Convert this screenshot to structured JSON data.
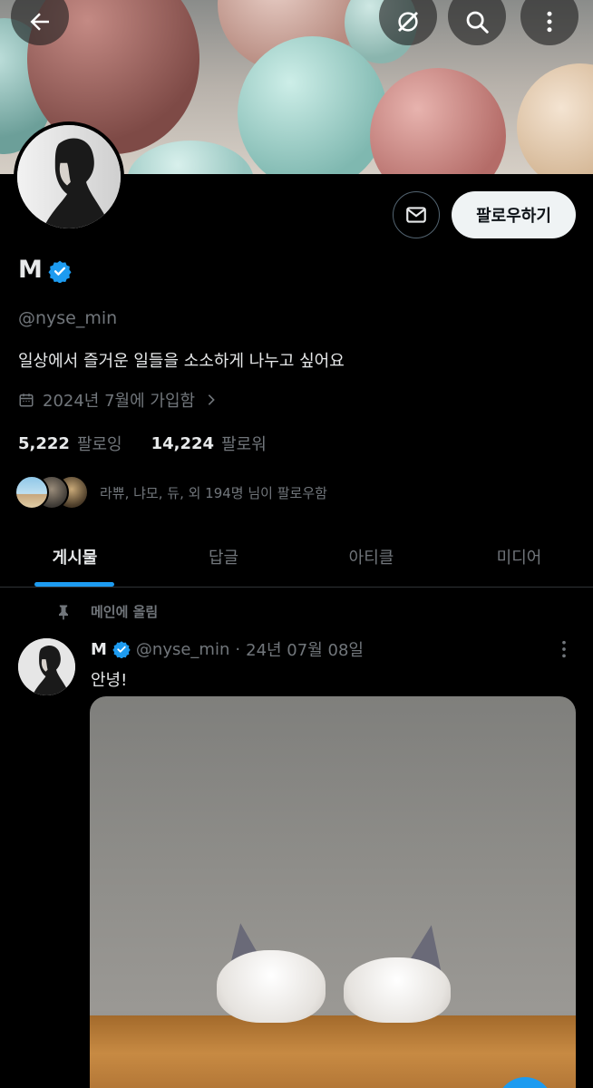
{
  "header": {
    "back_icon": "arrow-left-icon",
    "grok_icon": "grok-icon",
    "search_icon": "search-icon",
    "more_icon": "more-vertical-icon"
  },
  "profile": {
    "name": "M",
    "handle": "@nyse_min",
    "bio": "일상에서 즐거운 일들을 소소하게 나누고 싶어요",
    "joined": "2024년 7월에 가입함",
    "following_count": "5,222",
    "following_label": "팔로잉",
    "followers_count": "14,224",
    "followers_label": "팔로워",
    "known_followers": "라쀼, 냐모, 듀, 외 194명 님이 팔로우함",
    "follow_button": "팔로우하기",
    "verified_color": "#1d9bf0"
  },
  "tabs": [
    {
      "label": "게시물",
      "active": true
    },
    {
      "label": "답글",
      "active": false
    },
    {
      "label": "아티클",
      "active": false
    },
    {
      "label": "미디어",
      "active": false
    }
  ],
  "pinned": {
    "label": "메인에 올림"
  },
  "post": {
    "name": "M",
    "handle": "@nyse_min",
    "separator": "·",
    "date": "24년 07월 08일",
    "text": "안녕!"
  },
  "colors": {
    "background": "#000000",
    "accent": "#1d9bf0",
    "secondary_text": "#71767b"
  }
}
